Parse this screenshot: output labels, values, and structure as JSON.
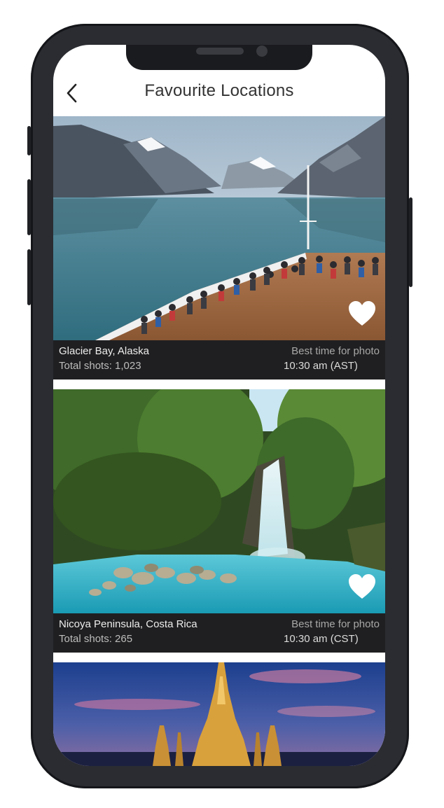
{
  "header": {
    "title": "Favourite Locations",
    "back_icon": "chevron-left-icon"
  },
  "locations": [
    {
      "name": "Glacier Bay, Alaska",
      "shots": "Total shots: 1,023",
      "best_label": "Best time for photo",
      "best_time": "10:30 am (AST)",
      "favourite": true,
      "heart_icon": "heart-icon"
    },
    {
      "name": "Nicoya Peninsula, Costa Rica",
      "shots": "Total shots: 265",
      "best_label": "Best time for photo",
      "best_time": "10:30 am (CST)",
      "favourite": true,
      "heart_icon": "heart-icon"
    },
    {
      "favourite": false
    }
  ],
  "colors": {
    "info_bar": "#1f1f21",
    "title_text": "#333333",
    "heart": "#ffffff",
    "phone_frame": "#2a2c31"
  }
}
